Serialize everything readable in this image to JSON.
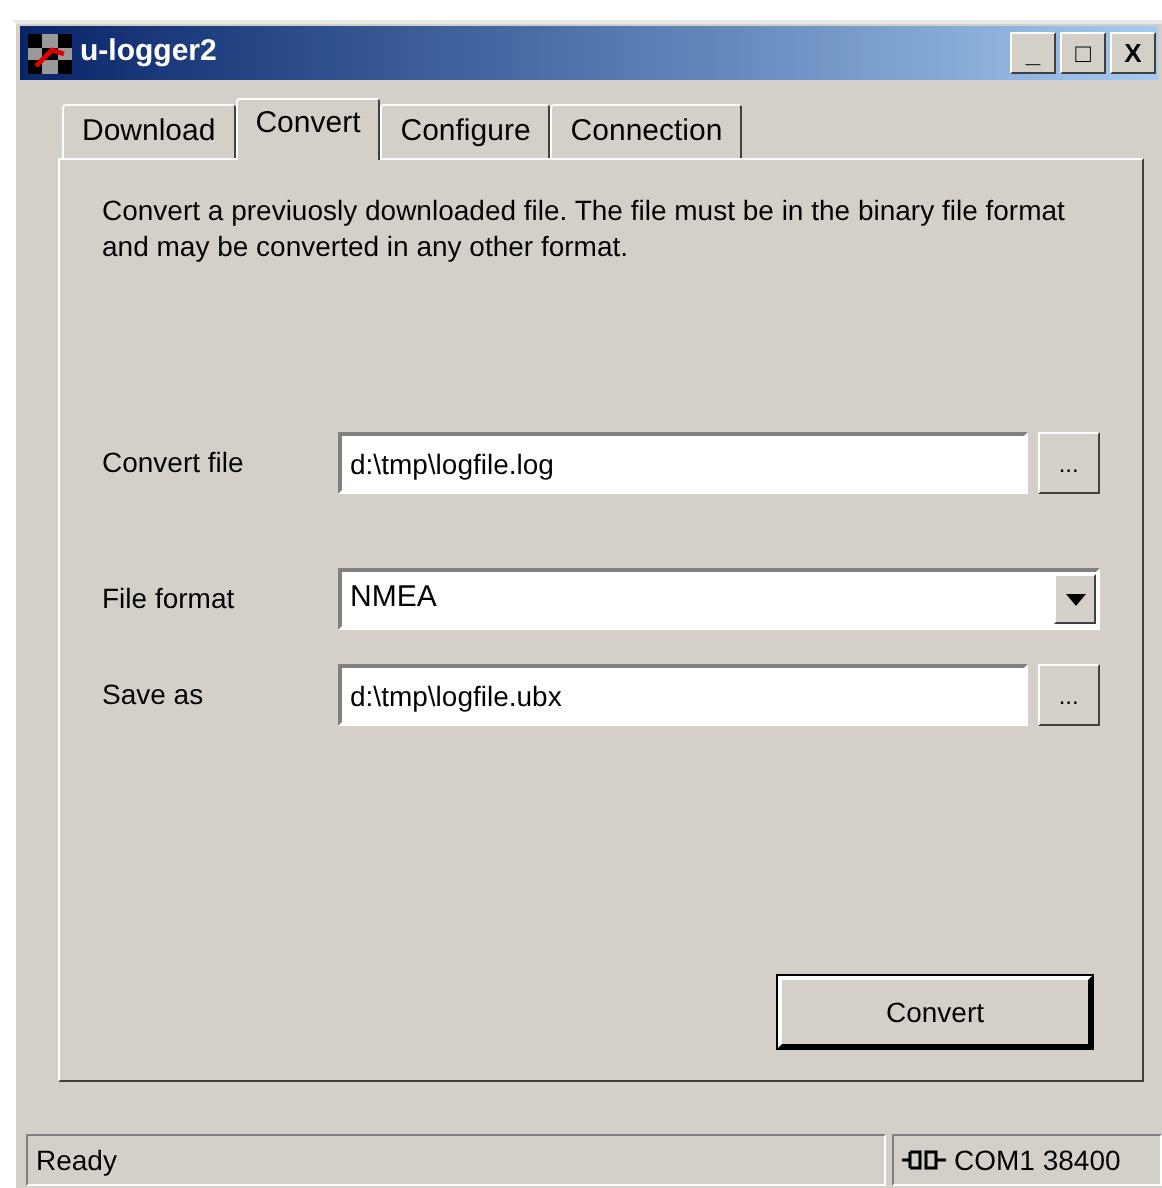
{
  "window": {
    "title": "u-logger2",
    "controls": [
      "_",
      "□",
      "X"
    ]
  },
  "tabs": [
    {
      "label": "Download",
      "selected": false
    },
    {
      "label": "Convert",
      "selected": true
    },
    {
      "label": "Configure",
      "selected": false
    },
    {
      "label": "Connection",
      "selected": false
    }
  ],
  "description": "Convert a previuosly downloaded file. The file must be in the binary file format and may be converted in any other format.",
  "fields": [
    {
      "kind": "file",
      "label": "Convert file",
      "value": "d:\\tmp\\logfile.log",
      "browse": "..."
    },
    {
      "kind": "select",
      "label": "File format",
      "value": "NMEA"
    },
    {
      "kind": "file",
      "label": "Save as",
      "value": "d:\\tmp\\logfile.ubx",
      "browse": "..."
    }
  ],
  "action_button": "Convert",
  "status_bar": {
    "message": "Ready",
    "connection": "COM1 38400"
  }
}
